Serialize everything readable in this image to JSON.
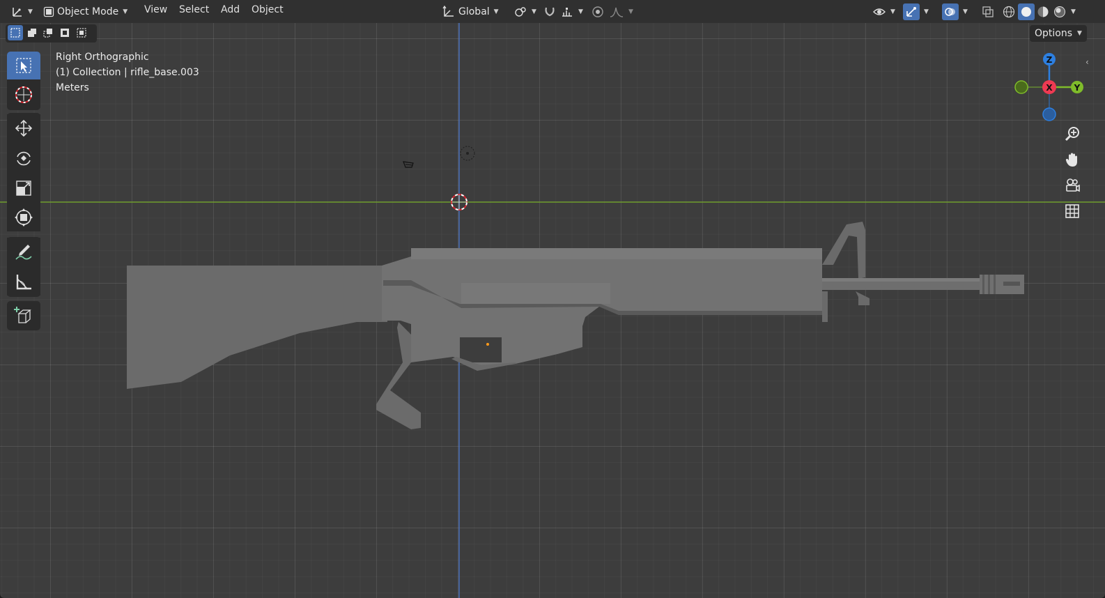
{
  "header": {
    "mode_label": "Object Mode",
    "menus": [
      "View",
      "Select",
      "Add",
      "Object"
    ],
    "orientation_label": "Global",
    "options_label": "Options"
  },
  "viewport": {
    "view_name": "Right Orthographic",
    "collection_info": "(1) Collection | rifle_base.003",
    "units": "Meters"
  },
  "gizmo": {
    "z_label": "Z",
    "x_label": "X",
    "y_label": "Y",
    "z_color": "#2d7fe0",
    "x_color": "#ee3a52",
    "y_color": "#7fbc2a"
  },
  "icons": {
    "toolbar": [
      "select-box-icon",
      "cursor-icon",
      "move-icon",
      "rotate-icon",
      "scale-icon",
      "transform-icon",
      "annotate-icon",
      "measure-icon",
      "add-cube-icon"
    ],
    "nav": [
      "zoom-icon",
      "pan-hand-icon",
      "camera-icon",
      "grid-icon"
    ]
  },
  "colors": {
    "active_tool": "#4772b3",
    "axis_y_line": "#6d9a2a",
    "axis_z_line": "#4a6fb8",
    "model_fill": "#6e6e6e"
  }
}
